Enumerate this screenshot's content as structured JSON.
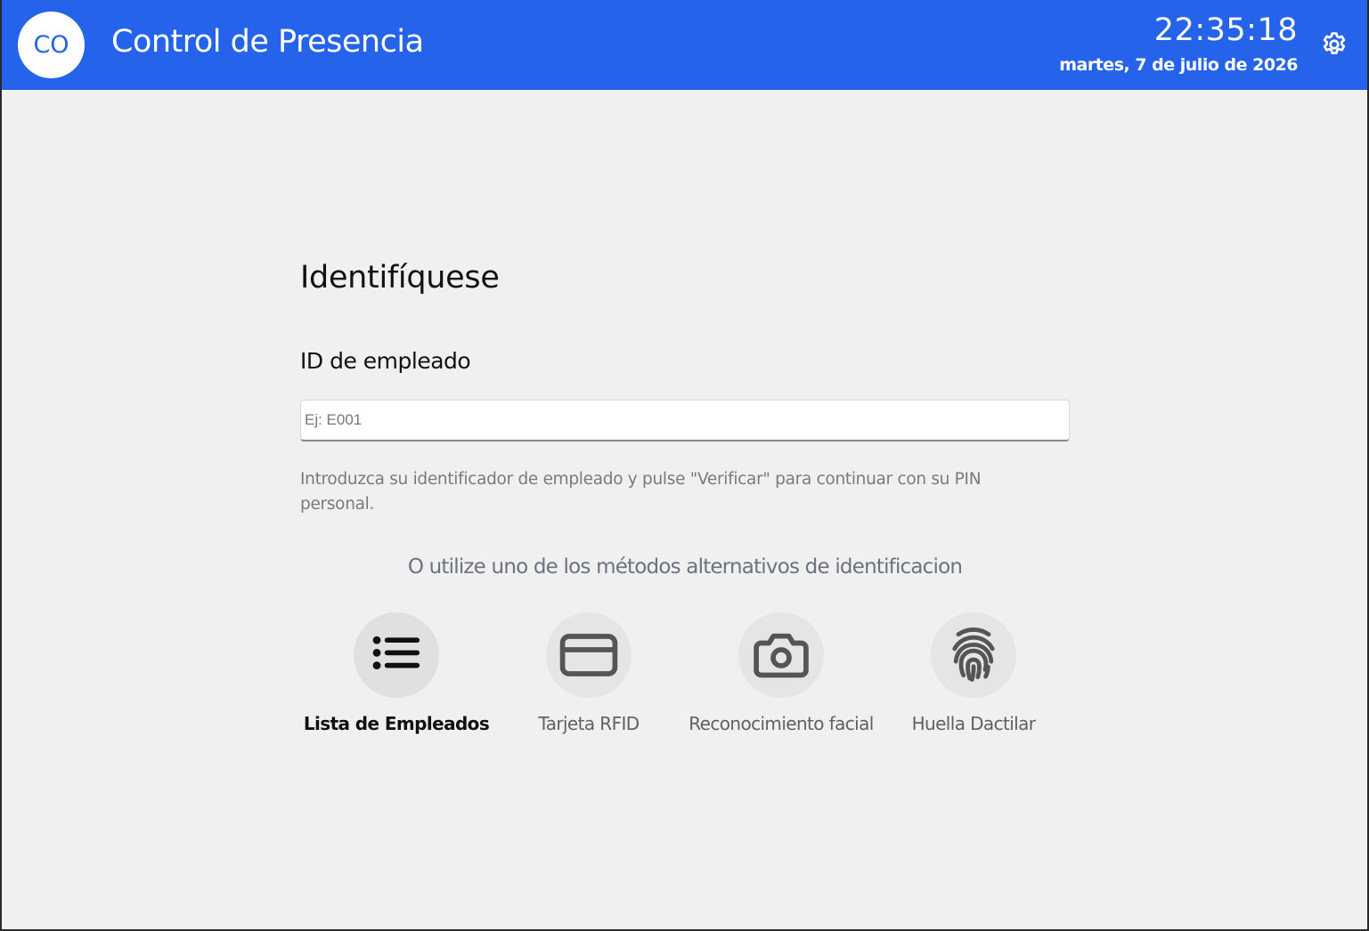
{
  "header": {
    "logo_text": "CO",
    "title": "Control de Presencia",
    "time": "22:35:18",
    "date": "martes, 7 de julio de 2026",
    "settings_icon": "gear-icon",
    "accent_color": "#2563eb"
  },
  "main": {
    "heading": "Identifíquese",
    "field_label": "ID de empleado",
    "id_input": {
      "value": "",
      "placeholder": "Ej: E001"
    },
    "help_text": "Introduzca su identificador de empleado y pulse \"Verificar\" para continuar con su PIN personal.",
    "alternatives_text": "O utilize uno de los métodos alternativos de identificacion",
    "methods": [
      {
        "label": "Lista de Empleados",
        "icon": "list-icon",
        "active": true
      },
      {
        "label": "Tarjeta RFID",
        "icon": "credit-card-icon",
        "active": false
      },
      {
        "label": "Reconocimiento facial",
        "icon": "camera-icon",
        "active": false
      },
      {
        "label": "Huella Dactilar",
        "icon": "fingerprint-icon",
        "active": false
      }
    ]
  }
}
